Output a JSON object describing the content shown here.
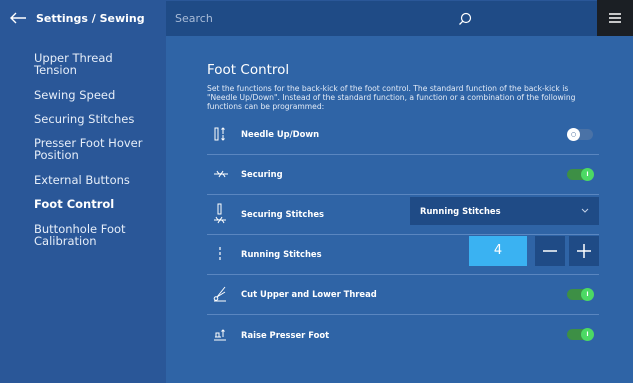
{
  "header": {
    "breadcrumb": "Settings / Sewing",
    "search_placeholder": "Search"
  },
  "icons": {
    "back": "arrow-left-icon",
    "search": "search-icon",
    "menu": "hamburger-icon"
  },
  "sidebar": {
    "items": [
      {
        "label": "Upper Thread Tension",
        "active": false
      },
      {
        "label": "Sewing Speed",
        "active": false
      },
      {
        "label": "Securing Stitches",
        "active": false
      },
      {
        "label": "Presser Foot Hover Position",
        "active": false
      },
      {
        "label": "External Buttons",
        "active": false
      },
      {
        "label": "Foot Control",
        "active": true
      },
      {
        "label": "Buttonhole Foot Calibration",
        "active": false
      }
    ]
  },
  "main": {
    "title": "Foot Control",
    "description": "Set the functions for the back-kick of the foot control. The standard function of the back-kick is \"Needle Up/Down\". Instead of the standard function, a function or a combination of the following functions can be programmed:",
    "rows": [
      {
        "label": "Needle Up/Down",
        "control": "toggle",
        "state": "off",
        "icon": "needle-up-down-icon"
      },
      {
        "label": "Securing",
        "control": "toggle",
        "state": "on",
        "icon": "securing-icon"
      },
      {
        "label": "Securing Stitches",
        "control": "dropdown",
        "value": "Running Stitches",
        "icon": "securing-stitches-icon"
      },
      {
        "label": "Running Stitches",
        "control": "stepper",
        "value": "4",
        "icon": "running-stitches-icon"
      },
      {
        "label": "Cut Upper and Lower Thread",
        "control": "toggle",
        "state": "on",
        "icon": "thread-cutter-icon"
      },
      {
        "label": "Raise Presser Foot",
        "control": "toggle",
        "state": "on",
        "icon": "raise-presser-foot-icon"
      }
    ]
  },
  "colors": {
    "background": "#2f64a6",
    "sidebar": "#2a5798",
    "toggle_on": "#4cd964",
    "stepper_value": "#3ab2f2"
  }
}
